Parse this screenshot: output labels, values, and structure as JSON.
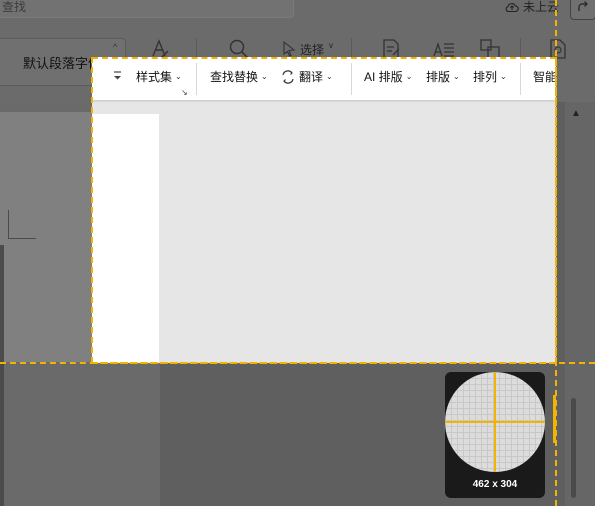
{
  "titlebar": {
    "search_text": "查找",
    "cloud_label": "未上云"
  },
  "ribbon": {
    "font_name": "默认段落字体",
    "style_set_label": "样式集",
    "find_label": "查找替换",
    "select_label": "选择",
    "translate_label": "翻译",
    "ai_layout_label": "AI 排版",
    "layout_label": "排版",
    "arrange_label": "排列",
    "smart_doc_label": "智能公文"
  },
  "capture": {
    "size_label": "462 x 304"
  },
  "colors": {
    "guide": "#f2b400",
    "overlay_dim": "#5f5f5f",
    "selection_bg": "#e6e6e6"
  }
}
